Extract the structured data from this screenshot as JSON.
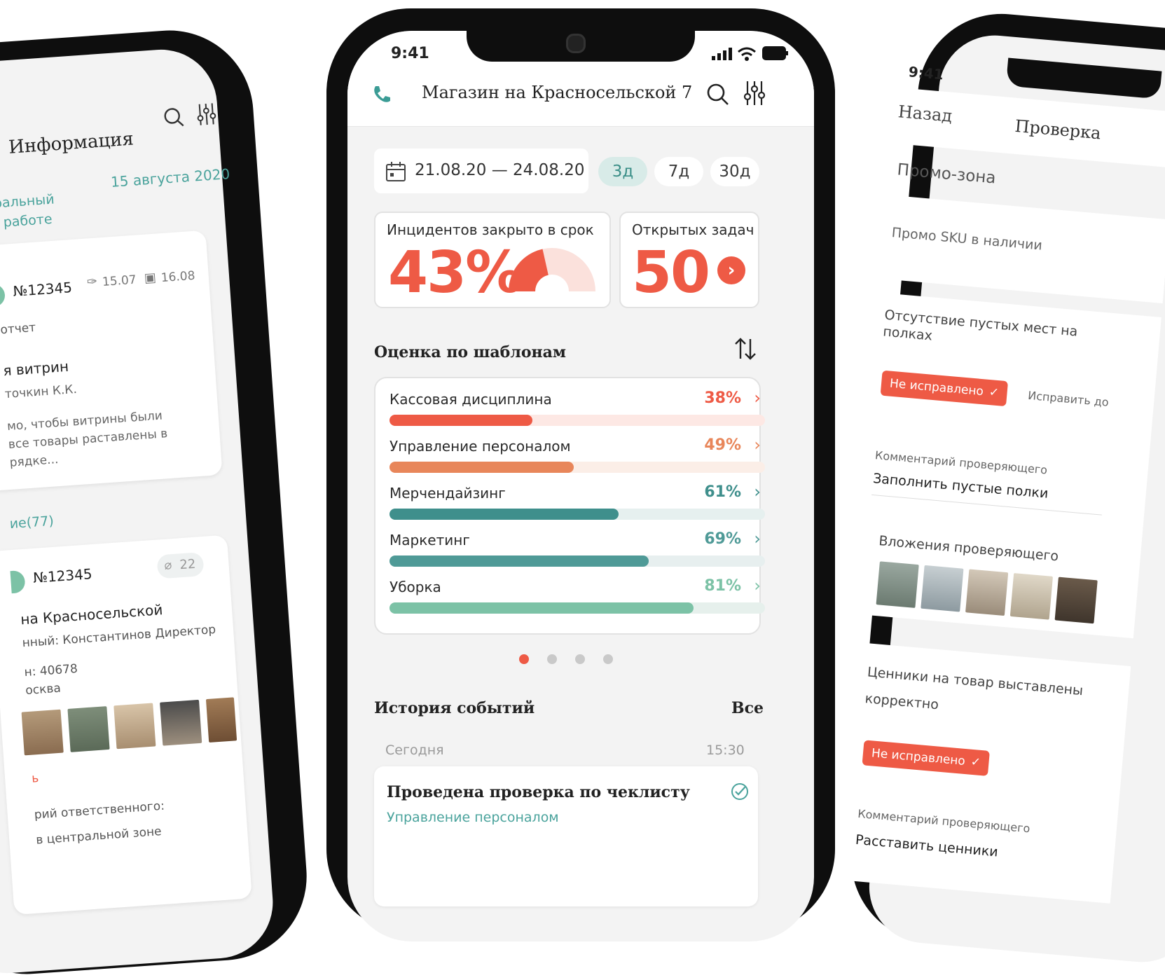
{
  "center": {
    "status_time": "9:41",
    "store_title": "Магазин на Красносельской 7",
    "date_range": "21.08.20 — 24.08.20",
    "period_tabs": [
      {
        "label": "3д",
        "active": true
      },
      {
        "label": "7д",
        "active": false
      },
      {
        "label": "30д",
        "active": false
      }
    ],
    "incidents": {
      "label": "Инцидентов закрыто в срок",
      "value": "43%",
      "fraction": 0.43
    },
    "open_tasks": {
      "label": "Открытых задач",
      "value": "50"
    },
    "templates_title": "Оценка по шаблонам",
    "templates": [
      {
        "label": "Кассовая дисциплина",
        "pct": "38%",
        "value": 0.38,
        "color": "#ee5a45",
        "track": "#fde8e4"
      },
      {
        "label": "Управление персоналом",
        "pct": "49%",
        "value": 0.49,
        "color": "#e8865a",
        "track": "#fbeee7"
      },
      {
        "label": "Мерчендайзинг",
        "pct": "61%",
        "value": 0.61,
        "color": "#3f8f8c",
        "track": "#e6f0ef"
      },
      {
        "label": "Маркетинг",
        "pct": "69%",
        "value": 0.69,
        "color": "#4f9a97",
        "track": "#e7efef"
      },
      {
        "label": "Уборка",
        "pct": "81%",
        "value": 0.81,
        "color": "#7cc2a6",
        "track": "#e6f0ec"
      }
    ],
    "pager": {
      "count": 4,
      "active": 0
    },
    "history_title": "История событий",
    "history_all": "Все",
    "history_day": "Сегодня",
    "history_time": "15:30",
    "event_title": "Проведена проверка по чеклисту",
    "event_subtitle": "Управление персоналом"
  },
  "left": {
    "title": "Информация",
    "date": "15 августа 2020",
    "zone": "тральный",
    "status": "В работе",
    "card1": {
      "number": "№12345",
      "pin_date": "15.07",
      "due_date": "16.08",
      "type": "отчет",
      "heading": "я витрин",
      "author": "точкин К.К.",
      "desc1": "мо, чтобы витрины были",
      "desc2": "все товары раставлены в",
      "desc3": "рядке..."
    },
    "section": "ие(77)",
    "card2": {
      "number": "№12345",
      "attachments": "22",
      "heading": "на Красносельской",
      "responsible": "нный: Константинов Директор",
      "code": "н: 40678",
      "city": "осква",
      "red_text": "ь",
      "comment_label": "рий ответственного:",
      "comment": "в центральной зоне"
    }
  },
  "right": {
    "status_time": "9:41",
    "back": "Назад",
    "title": "Проверка",
    "section": "Промо-зона",
    "item1": "Промо SKU в наличии",
    "item2_line1": "Отсутствие пустых мест на",
    "item2_line2": "полках",
    "not_fixed": "Не исправлено",
    "fix_until": "Исправить до",
    "comment_label": "Комментарий проверяющего",
    "comment1": "Заполнить пустые полки",
    "attachments_label": "Вложения проверяющего",
    "item3_line1": "Ценники на товар выставлены",
    "item3_line2": "корректно",
    "comment2": "Расставить ценники"
  },
  "colors": {
    "accent": "#ee5a45",
    "teal": "#3f8f8c"
  }
}
